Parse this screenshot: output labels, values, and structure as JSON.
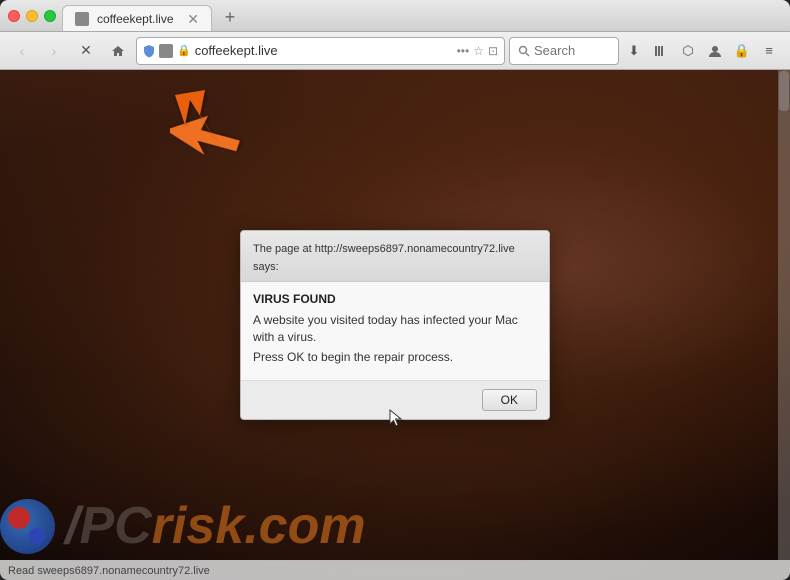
{
  "browser": {
    "tab": {
      "title": "coffeekept.live",
      "favicon_color": "#888"
    },
    "new_tab_icon": "+",
    "nav": {
      "back_label": "‹",
      "forward_label": "›",
      "reload_label": "✕",
      "home_label": "⌂",
      "address": "coffeekept.live",
      "shield_label": "🛡",
      "dots_label": "•••",
      "bookmark_label": "☆",
      "reader_label": "≡"
    },
    "search": {
      "placeholder": "Search",
      "value": ""
    },
    "toolbar": {
      "download_icon": "⬇",
      "bookmarks_icon": "|||",
      "extensions_icon": "⬡",
      "profile_icon": "👤",
      "lock_icon": "🔒",
      "menu_icon": "≡"
    }
  },
  "dialog": {
    "title": "The page at http://sweeps6897.nonamecountry72.live says:",
    "virus_label": "VIRUS FOUND",
    "message1": "A website you visited today has infected your Mac with a virus.",
    "message2": "Press OK to begin the repair process.",
    "ok_button": "OK"
  },
  "status": {
    "text": "Read sweeps6897.nonamecountry72.live"
  },
  "watermark": {
    "brand_pc": "PC",
    "separator": "/",
    "brand_risk": "risk",
    "dot_com": ".com"
  }
}
